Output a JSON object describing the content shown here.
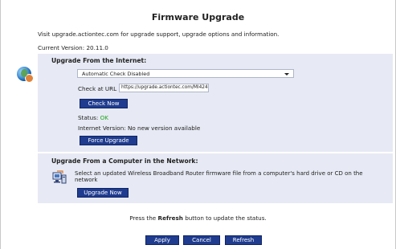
{
  "page": {
    "title": "Firmware Upgrade",
    "intro": "Visit upgrade.actiontec.com for upgrade support, upgrade options and information.",
    "current_version_label": "Current Version:",
    "current_version_value": "20.11.0"
  },
  "internet_section": {
    "title": "Upgrade From the Internet:",
    "mode_select_value": "Automatic Check Disabled",
    "check_url_label": "Check at URL",
    "check_url_value": "https://upgrade.actiontec.com/MI424",
    "check_now_label": "Check Now",
    "status_label": "Status:",
    "status_value": "OK",
    "internet_version_label": "Internet Version:",
    "internet_version_value": "No new version available",
    "force_upgrade_label": "Force Upgrade"
  },
  "network_section": {
    "title": "Upgrade From a Computer in the Network:",
    "description": "Select an updated Wireless Broadband Router firmware file from a computer's hard drive or CD on the network",
    "upgrade_now_label": "Upgrade Now"
  },
  "footer": {
    "note_prefix": "Press the",
    "note_bold": "Refresh",
    "note_suffix": "button to update the status.",
    "apply_label": "Apply",
    "cancel_label": "Cancel",
    "refresh_label": "Refresh"
  },
  "colors": {
    "button_bg": "#1f3c8f",
    "panel_bg": "#e7eaf4",
    "status_ok": "#21a321"
  },
  "icons": {
    "internet": "globe-icon",
    "network": "computer-icon",
    "dropdown": "chevron-down-icon"
  }
}
